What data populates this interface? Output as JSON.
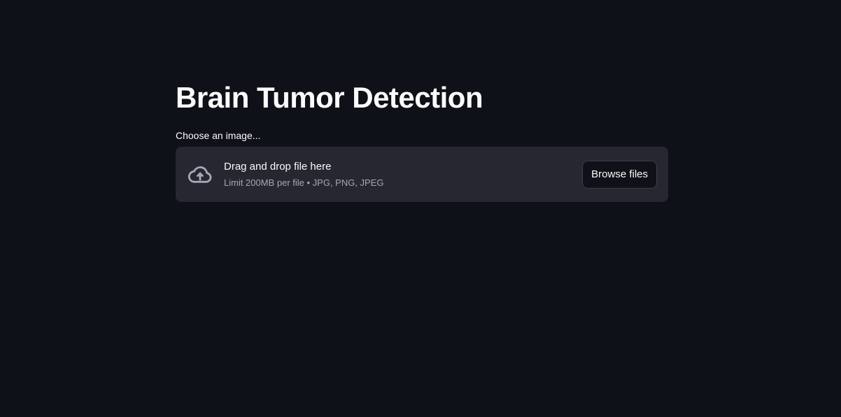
{
  "page": {
    "title": "Brain Tumor Detection"
  },
  "uploader": {
    "label": "Choose an image...",
    "drag_text": "Drag and drop file here",
    "limit_text": "Limit 200MB per file • JPG, PNG, JPEG",
    "browse_label": "Browse files",
    "icon": "cloud-upload-icon"
  },
  "colors": {
    "background": "#0e1117",
    "dropzone": "#262730",
    "text": "#fafafa",
    "muted": "#a3a8b8"
  }
}
